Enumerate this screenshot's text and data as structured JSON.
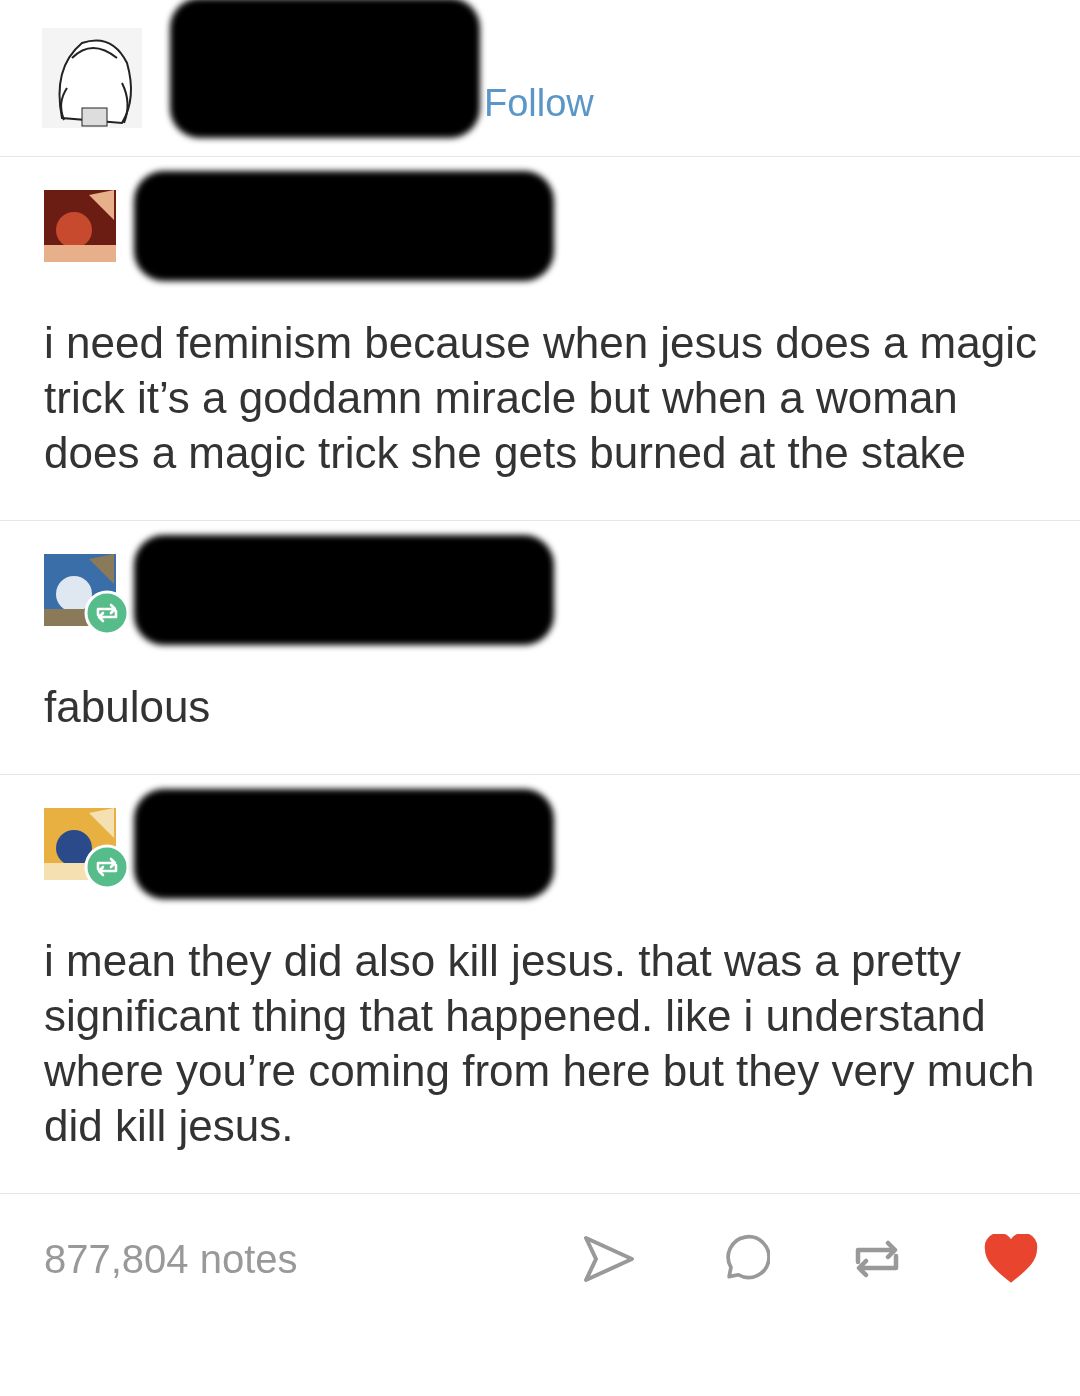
{
  "header": {
    "follow_link": "Follow"
  },
  "posts": [
    {
      "kind": "original",
      "text": "i need feminism because when jesus does a magic trick it’s a goddamn miracle but when a woman does a magic trick she gets burned at the stake"
    },
    {
      "kind": "reblog",
      "text": "fabulous"
    },
    {
      "kind": "reblog",
      "text": "i mean they did also kill jesus. that was a pretty significant thing that happened. like i understand where you’re coming from here but they very much did kill jesus."
    }
  ],
  "footer": {
    "notes": "877,804 notes",
    "liked": true
  }
}
